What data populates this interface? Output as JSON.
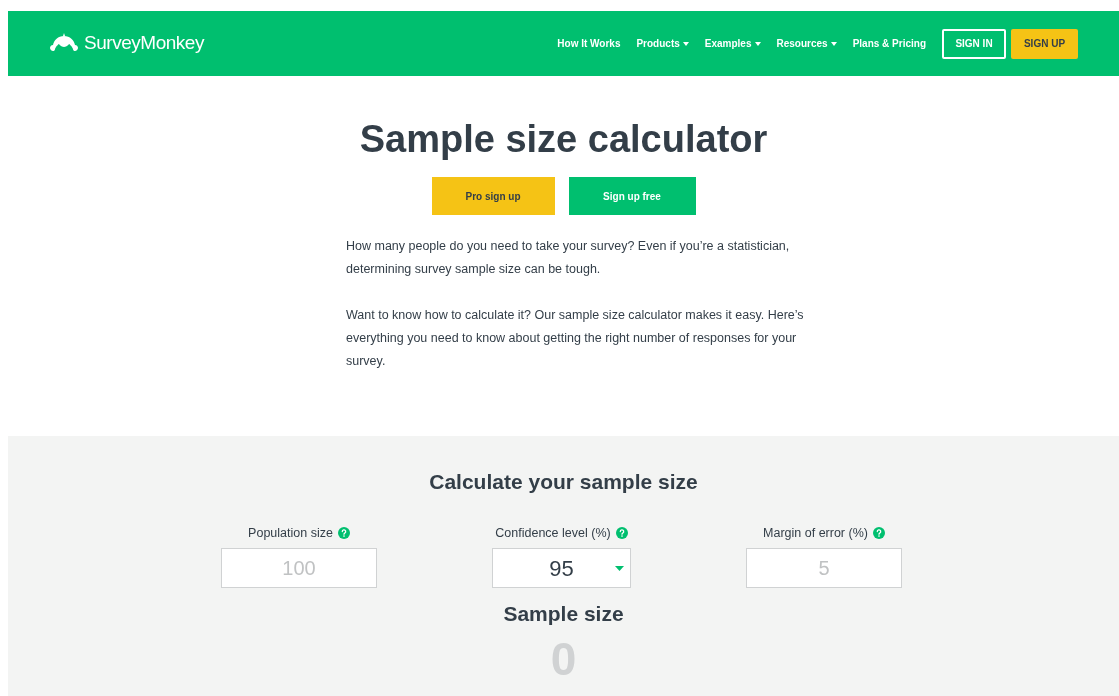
{
  "header": {
    "logo": "SurveyMonkey",
    "nav": [
      {
        "label": "How It Works",
        "dropdown": false
      },
      {
        "label": "Products",
        "dropdown": true
      },
      {
        "label": "Examples",
        "dropdown": true
      },
      {
        "label": "Resources",
        "dropdown": true
      },
      {
        "label": "Plans & Pricing",
        "dropdown": false
      }
    ],
    "sign_in": "SIGN IN",
    "sign_up": "SIGN UP"
  },
  "hero": {
    "title": "Sample size calculator",
    "buttons": [
      {
        "label": "Pro sign up",
        "kind": "pro"
      },
      {
        "label": "Sign up free",
        "kind": "free"
      }
    ],
    "paragraphs": [
      "How many people do you need to take your survey? Even if you’re a statistician, determining survey sample size can be tough.",
      "Want to know how to calculate it? Our sample size calculator makes it easy. Here’s everything you need to know about getting the right number of responses for your survey."
    ]
  },
  "calculator": {
    "title": "Calculate your sample size",
    "fields": [
      {
        "label": "Population size",
        "kind": "input",
        "placeholder": "100"
      },
      {
        "label": "Confidence level (%)",
        "kind": "select",
        "value": "95"
      },
      {
        "label": "Margin of error (%)",
        "kind": "input",
        "placeholder": "5"
      }
    ],
    "result_label": "Sample size",
    "result": "0"
  }
}
